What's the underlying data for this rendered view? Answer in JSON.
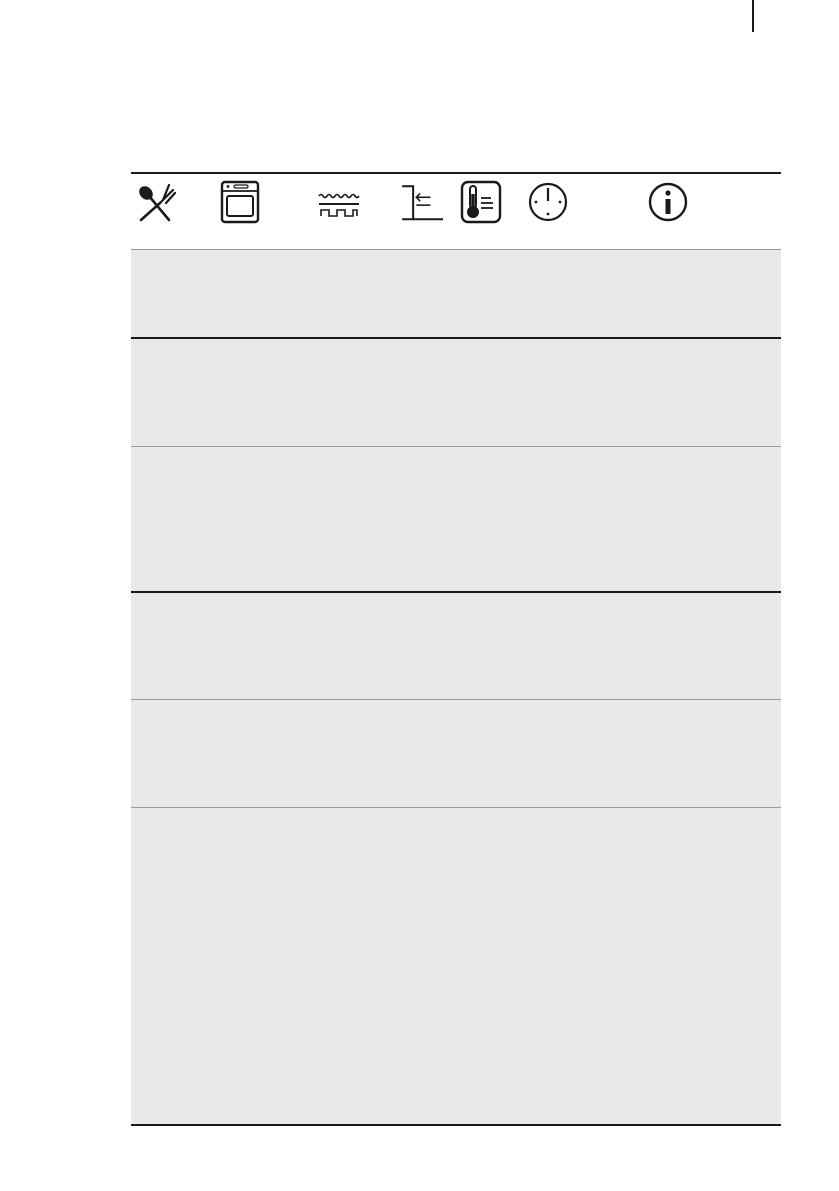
{
  "header": {
    "icons": [
      {
        "name": "cutlery-icon"
      },
      {
        "name": "oven-icon"
      },
      {
        "name": "heating-function-icon"
      },
      {
        "name": "shelf-position-icon"
      },
      {
        "name": "temperature-icon"
      },
      {
        "name": "time-icon"
      },
      {
        "name": "information-icon"
      }
    ]
  },
  "rows": [
    {
      "cells": []
    },
    {
      "cells": []
    },
    {
      "cells": []
    },
    {
      "cells": []
    },
    {
      "cells": []
    },
    {
      "cells": []
    }
  ]
}
